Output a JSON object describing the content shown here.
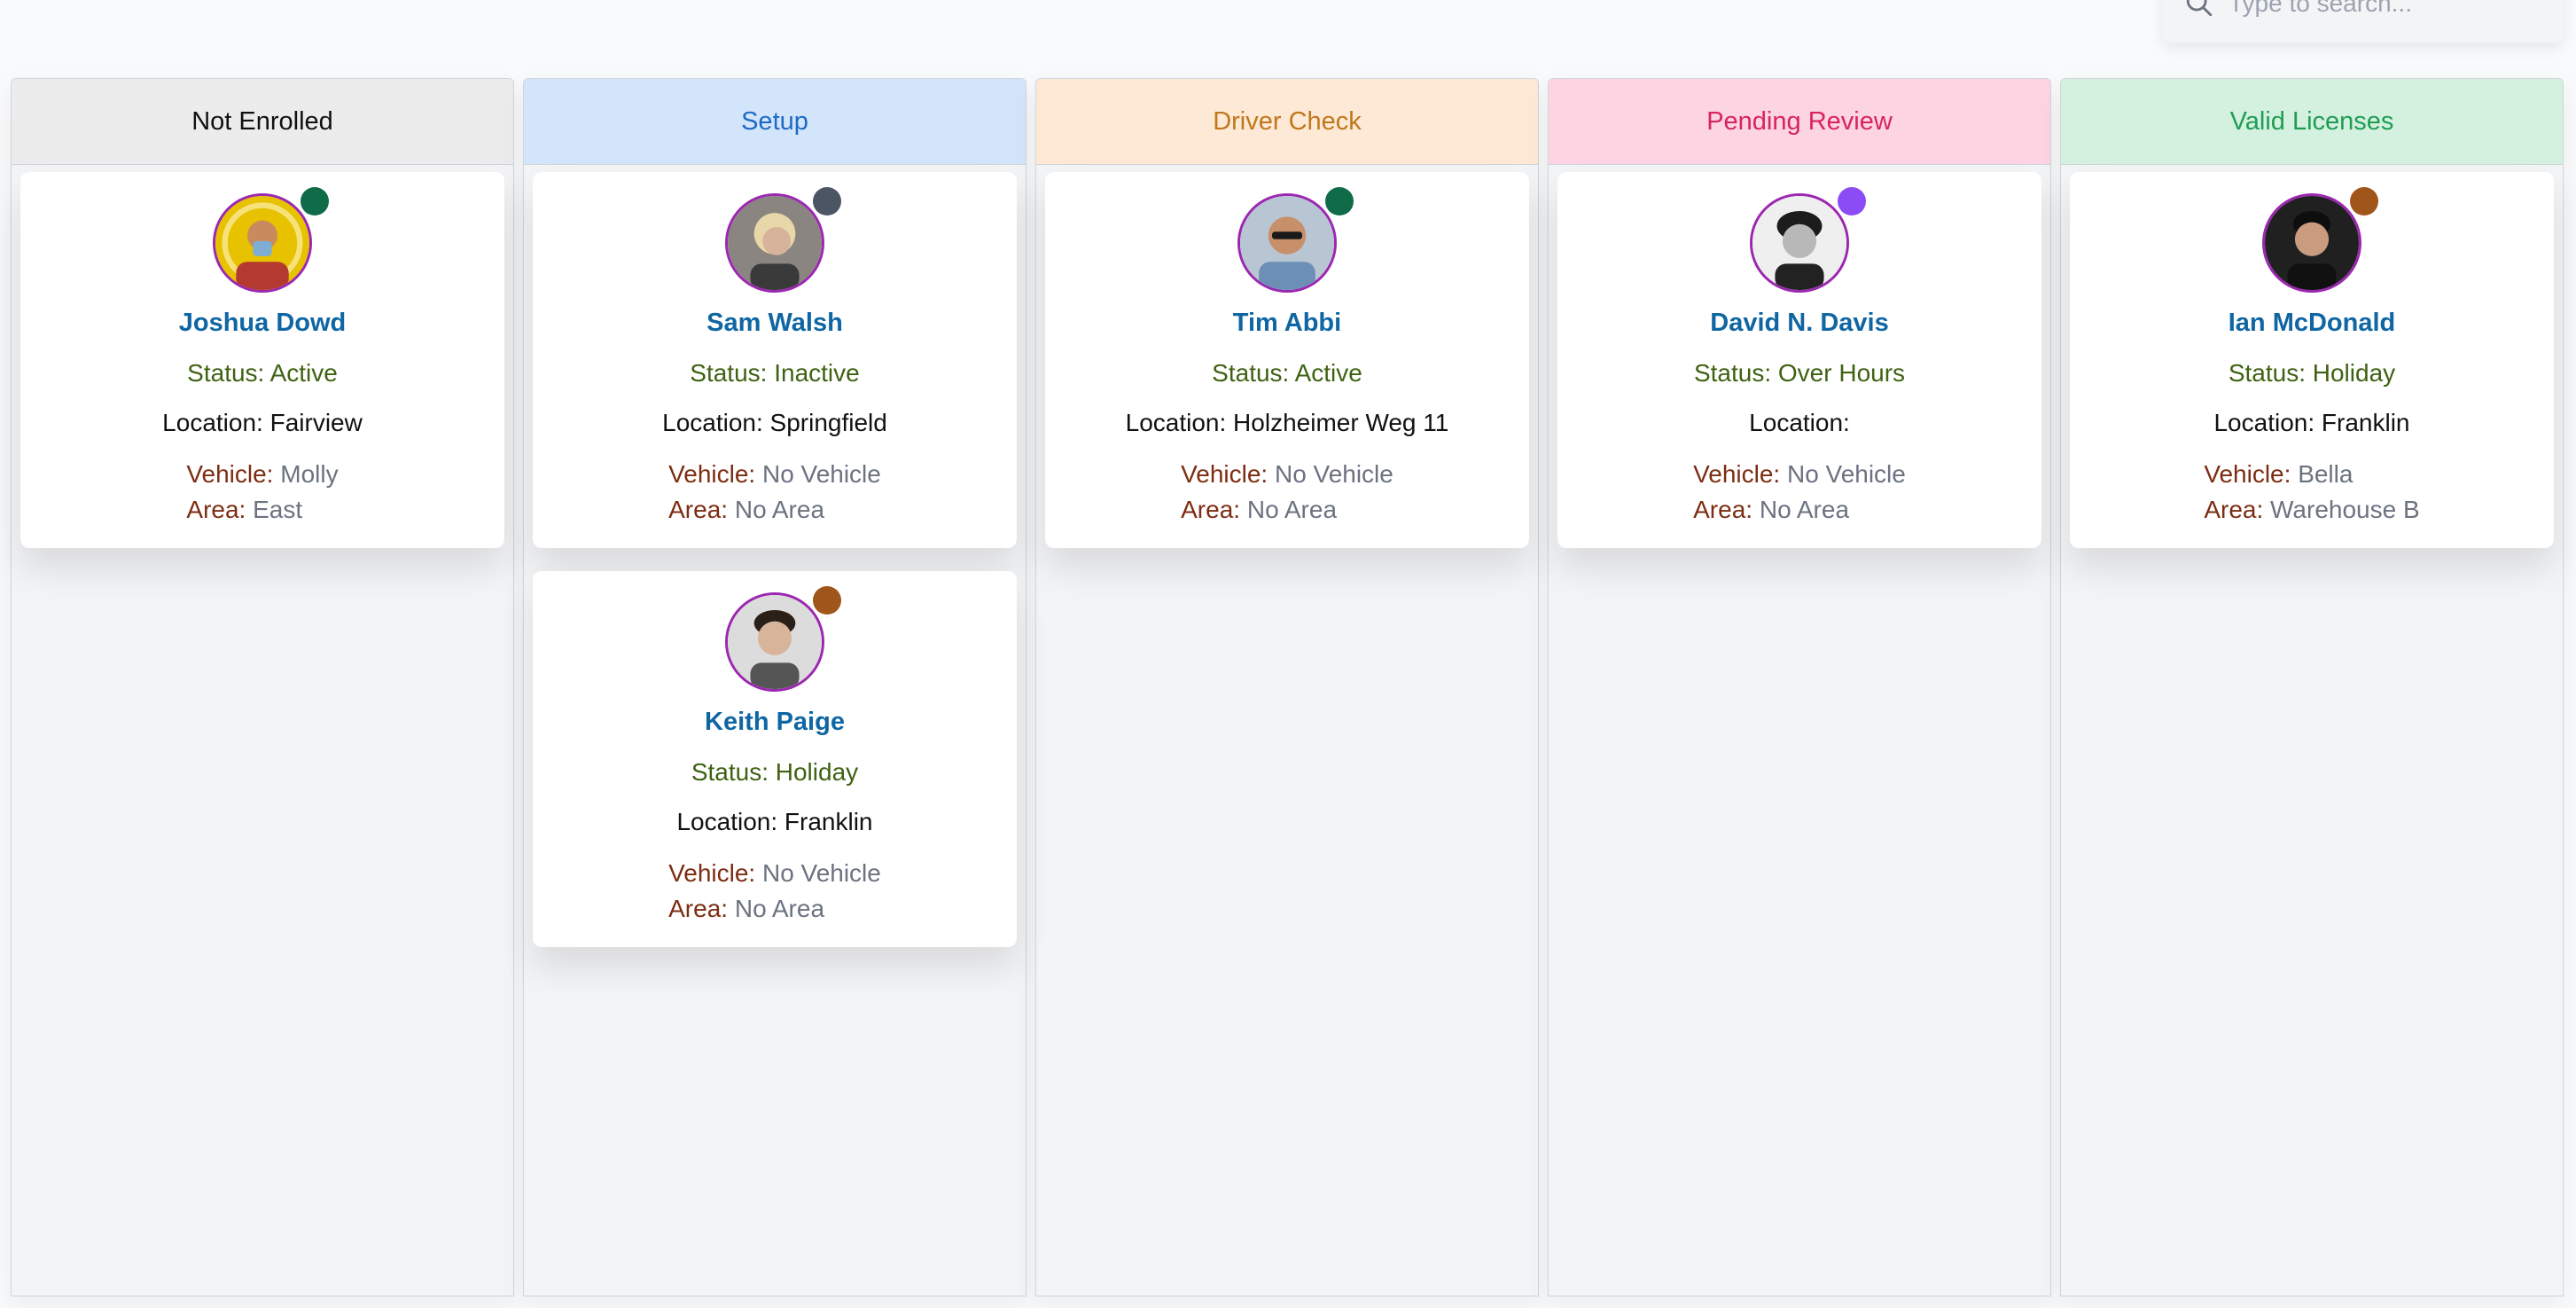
{
  "search": {
    "placeholder": "Type to search..."
  },
  "columns": [
    {
      "title": "Not Enrolled",
      "head_bg": "#ececec",
      "head_color": "#111111",
      "cards": [
        {
          "name": "Joshua Dowd",
          "status": "Status: Active",
          "location": "Location: Fairview",
          "vehicle_label": "Vehicle:",
          "vehicle": "Molly",
          "area_label": "Area:",
          "area": "East",
          "dot_color": "#0f6b48"
        }
      ]
    },
    {
      "title": "Setup",
      "head_bg": "#d3e5fb",
      "head_color": "#1e6bc4",
      "cards": [
        {
          "name": "Sam Walsh",
          "status": "Status: Inactive",
          "location": "Location: Springfield",
          "vehicle_label": "Vehicle:",
          "vehicle": "No Vehicle",
          "area_label": "Area:",
          "area": "No Area",
          "dot_color": "#4b5563"
        },
        {
          "name": "Keith Paige",
          "status": "Status: Holiday",
          "location": "Location: Franklin",
          "vehicle_label": "Vehicle:",
          "vehicle": "No Vehicle",
          "area_label": "Area:",
          "area": "No Area",
          "dot_color": "#a0551a"
        }
      ]
    },
    {
      "title": "Driver Check",
      "head_bg": "#fde9d6",
      "head_color": "#c0781a",
      "cards": [
        {
          "name": "Tim Abbi",
          "status": "Status: Active",
          "location": "Location: Holzheimer Weg 11",
          "vehicle_label": "Vehicle:",
          "vehicle": "No Vehicle",
          "area_label": "Area:",
          "area": "No Area",
          "dot_color": "#0f6b48"
        }
      ]
    },
    {
      "title": "Pending Review",
      "head_bg": "#fcd4e2",
      "head_color": "#d8245e",
      "cards": [
        {
          "name": "David N. Davis",
          "status": "Status: Over Hours",
          "location": "Location:",
          "vehicle_label": "Vehicle:",
          "vehicle": "No Vehicle",
          "area_label": "Area:",
          "area": "No Area",
          "dot_color": "#8b4cf6"
        }
      ]
    },
    {
      "title": "Valid Licenses",
      "head_bg": "#d3f1de",
      "head_color": "#1f9d55",
      "cards": [
        {
          "name": "Ian McDonald",
          "status": "Status: Holiday",
          "location": "Location: Franklin",
          "vehicle_label": "Vehicle:",
          "vehicle": "Bella",
          "area_label": "Area:",
          "area": "Warehouse B",
          "dot_color": "#a0551a"
        }
      ]
    }
  ]
}
